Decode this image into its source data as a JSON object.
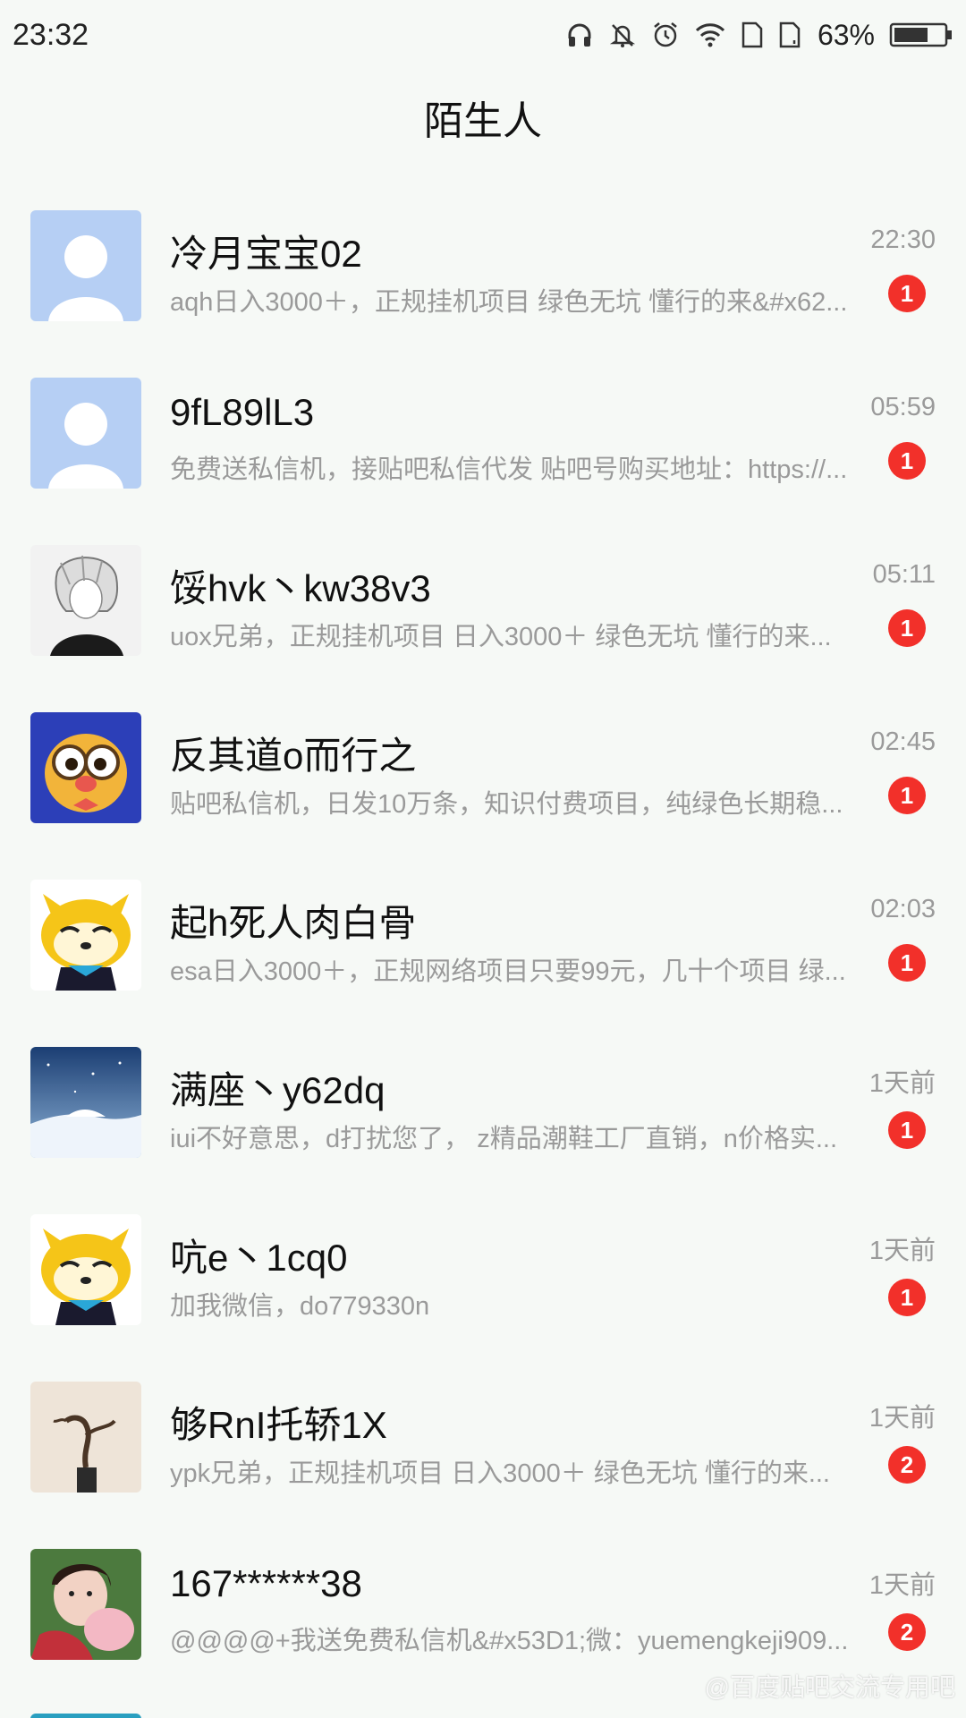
{
  "status_bar": {
    "time": "23:32",
    "battery": "63%",
    "icons": [
      "headphones-icon",
      "mute-bell-icon",
      "alarm-icon",
      "wifi-icon",
      "sim1-icon",
      "sim2-icon",
      "battery-icon"
    ]
  },
  "header": {
    "title": "陌生人"
  },
  "conversations": [
    {
      "name": "冷月宝宝02",
      "time": "22:30",
      "preview": "aqh日入3000＋，正规挂机项目 绿色无坑 懂行的来&#x62...",
      "unread": "1",
      "avatar": "default-avatar"
    },
    {
      "name": "9fL89lL3",
      "time": "05:59",
      "preview": "免费送私信机，接贴吧私信代发 贴吧号购买地址：https://...",
      "unread": "1",
      "avatar": "default-avatar"
    },
    {
      "name": "馁hvk丶kw38v3",
      "time": "05:11",
      "preview": "uox兄弟，正规挂机项目 日入3000＋  绿色无坑 懂行的来...",
      "unread": "1",
      "avatar": "anime-avatar"
    },
    {
      "name": "反其道o而行之",
      "time": "02:45",
      "preview": "贴吧私信机，日发10万条，知识付费项目，纯绿色长期稳...",
      "unread": "1",
      "avatar": "owl-avatar"
    },
    {
      "name": "起h死人肉白骨",
      "time": "02:03",
      "preview": "esa日入3000＋，正规网络项目只要99元，几十个项目 绿...",
      "unread": "1",
      "avatar": "raccoon-avatar"
    },
    {
      "name": "满座丶y62dq",
      "time": "1天前",
      "preview": "iui不好意思，d打扰您了， z精品潮鞋工厂直销，n价格实...",
      "unread": "1",
      "avatar": "snow-avatar"
    },
    {
      "name": "吭e丶1cq0",
      "time": "1天前",
      "preview": "加我微信，do779330n",
      "unread": "1",
      "avatar": "raccoon-avatar"
    },
    {
      "name": "够RnI托轿1X",
      "time": "1天前",
      "preview": "ypk兄弟，正规挂机项目 日入3000＋  绿色无坑 懂行的来...",
      "unread": "2",
      "avatar": "bonsai-avatar"
    },
    {
      "name": "167******38",
      "time": "1天前",
      "preview": "@@@@+我送免费私信机&#x53D1;微：yuemengkeji909...",
      "unread": "2",
      "avatar": "photo-avatar"
    }
  ],
  "watermark": "@百度贴吧交流专用吧"
}
